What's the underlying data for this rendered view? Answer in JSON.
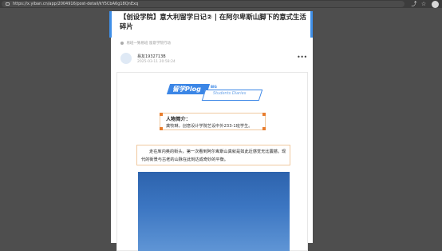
{
  "browser": {
    "url": "https://x.yiban.cn/app/2004916/post-detail/kY5CbA6g18QnExq"
  },
  "post": {
    "title": "【创设学院】意大利留学日记② | 在阿尔卑斯山脚下的意式生活碎片",
    "meta": "易班一致易班  留意学院行动",
    "author_name": "易友1932713B",
    "date": "2025-03-11 20:58:24"
  },
  "article": {
    "logo_main": "留学Plog",
    "logo_mini": "BIG",
    "logo_sub": "Students Diaries",
    "profile_heading": "人物简介：",
    "profile_text": "龚牧琳，创意设计学院艺设中外233-1班学生。",
    "paragraph": "走在库内奥的街头，第一次看到阿尔卑斯山真就是如此近感觉无比震撼。现代的街景与古老的山脉在此刻达成奇妙的平衡。"
  },
  "colors": {
    "accent": "#3f8fe8",
    "frame_orange": "#e87d2d"
  },
  "icons": [
    "lock-icon",
    "share-icon",
    "star-icon",
    "profile-icon",
    "more-icon"
  ]
}
